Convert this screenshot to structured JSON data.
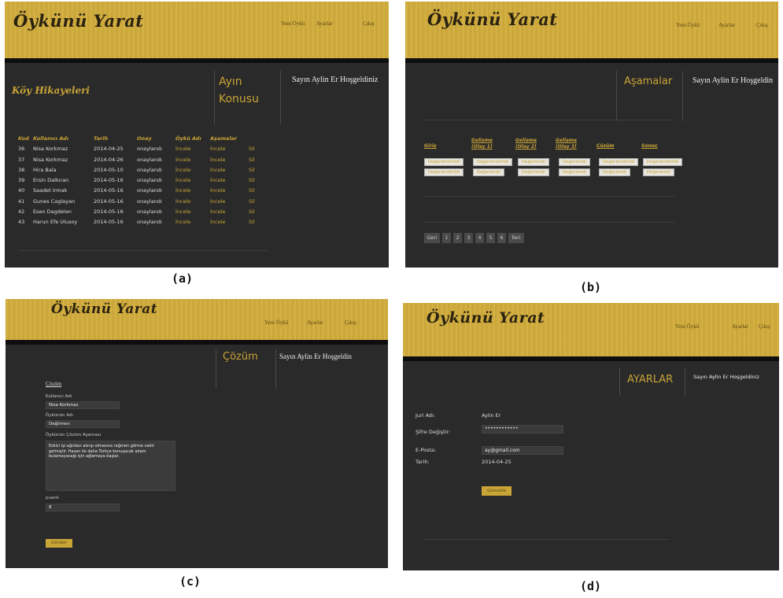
{
  "site": {
    "logo": "Öykünü Yarat"
  },
  "nav": {
    "new_story": "Yeni Öykü",
    "settings": "Ayarlar",
    "logout": "Çıkış"
  },
  "captions": {
    "a": "(a)",
    "b": "(b)",
    "c": "(c)",
    "d": "(d)"
  },
  "panel_a": {
    "page_title": "Köy Hikayeleri",
    "side_title_1": "Ayın",
    "side_title_2": "Konusu",
    "welcome": "Sayın Aylin Er Hoşgeldiniz",
    "columns": [
      "Kod",
      "Kullanıcı Adı",
      "Tarih",
      "Onay",
      "Öykü Adı",
      "Aşamalar"
    ],
    "rows": [
      {
        "kod": "36",
        "user": "Nisa Korkmaz",
        "date": "2014-04-25",
        "status": "onaylandı",
        "story": "İncele",
        "stages": "İncele",
        "action": "Sil"
      },
      {
        "kod": "37",
        "user": "Nisa Korkmaz",
        "date": "2014-04-26",
        "status": "onaylandı",
        "story": "İncele",
        "stages": "İncele",
        "action": "Sil"
      },
      {
        "kod": "38",
        "user": "Hira Bala",
        "date": "2014-05-10",
        "status": "onaylandı",
        "story": "İncele",
        "stages": "İncele",
        "action": "Sil"
      },
      {
        "kod": "39",
        "user": "Ersin Dalkıran",
        "date": "2014-05-16",
        "status": "onaylandı",
        "story": "İncele",
        "stages": "İncele",
        "action": "Sil"
      },
      {
        "kod": "40",
        "user": "Saadet Irmak",
        "date": "2014-05-16",
        "status": "onaylandı",
        "story": "İncele",
        "stages": "İncele",
        "action": "Sil"
      },
      {
        "kod": "41",
        "user": "Gunes Caglayan",
        "date": "2014-05-16",
        "status": "onaylandı",
        "story": "İncele",
        "stages": "İncele",
        "action": "Sil"
      },
      {
        "kod": "42",
        "user": "Esen Dagdelen",
        "date": "2014-05-16",
        "status": "onaylandı",
        "story": "İncele",
        "stages": "İncele",
        "action": "Sil"
      },
      {
        "kod": "43",
        "user": "Harun Efe Ulusoy",
        "date": "2014-05-16",
        "status": "onaylandı",
        "story": "İncele",
        "stages": "İncele",
        "action": "Sil"
      }
    ]
  },
  "panel_b": {
    "page_title": "Aşamalar",
    "welcome": "Sayın Aylin Er Hoşgeldin",
    "columns": [
      {
        "l1": "Giriş",
        "l2": ""
      },
      {
        "l1": "Gelişme",
        "l2": "(Olay 1)"
      },
      {
        "l1": "Gelişme",
        "l2": "(Olay 2)"
      },
      {
        "l1": "Gelişme",
        "l2": "(Olay 3)"
      },
      {
        "l1": "Çözüm",
        "l2": ""
      },
      {
        "l1": "Sonuç",
        "l2": ""
      }
    ],
    "row1": [
      "Değerlendirildi",
      "Değerlendirildi",
      "Değerlendi",
      "Değerlendi",
      "Değerlendirildi",
      "Değerlendirildi"
    ],
    "row2": [
      "Değerlendirildi",
      "Değerlendi",
      "Değerlendi",
      "Değerlendi",
      "Değerlendi",
      "Değerlendi"
    ],
    "pagination": [
      "Geri",
      "1",
      "2",
      "3",
      "4",
      "5",
      "6",
      "İleri"
    ]
  },
  "panel_c": {
    "page_title": "Çözüm",
    "welcome": "Sayın Aylin Er Hoşgeldin",
    "form_title": "Çözüm",
    "username_label": "Kullanıcı Adı",
    "username_value": "Nisa Korkmaz",
    "story_label": "Öykünün Adı",
    "story_value": "Değirmen",
    "solution_label": "Öykünün Çözüm Aşaması",
    "solution_text": "Eskici işi ağırdan alınıp olmasına rağmen görme vakti gelmiştir. Hasan ile daha Türkçe konuşacak adam bulamayacağı için ağlamaya başlar.",
    "score_label": "puanlı",
    "score_value": "8",
    "submit": "Gönder"
  },
  "panel_d": {
    "page_title": "AYARLAR",
    "welcome": "Sayın Aylin Er Hoşgeldiniz",
    "jury_label": "Juri Adı:",
    "jury_value": "Aylin Er",
    "password_label": "Şifre Değiştir:",
    "password_value": "••••••••••••",
    "email_label": "E-Posta:",
    "email_value": "ay@gmail.com",
    "date_label": "Tarih:",
    "date_value": "2014-04-25",
    "update": "Güncelle"
  }
}
